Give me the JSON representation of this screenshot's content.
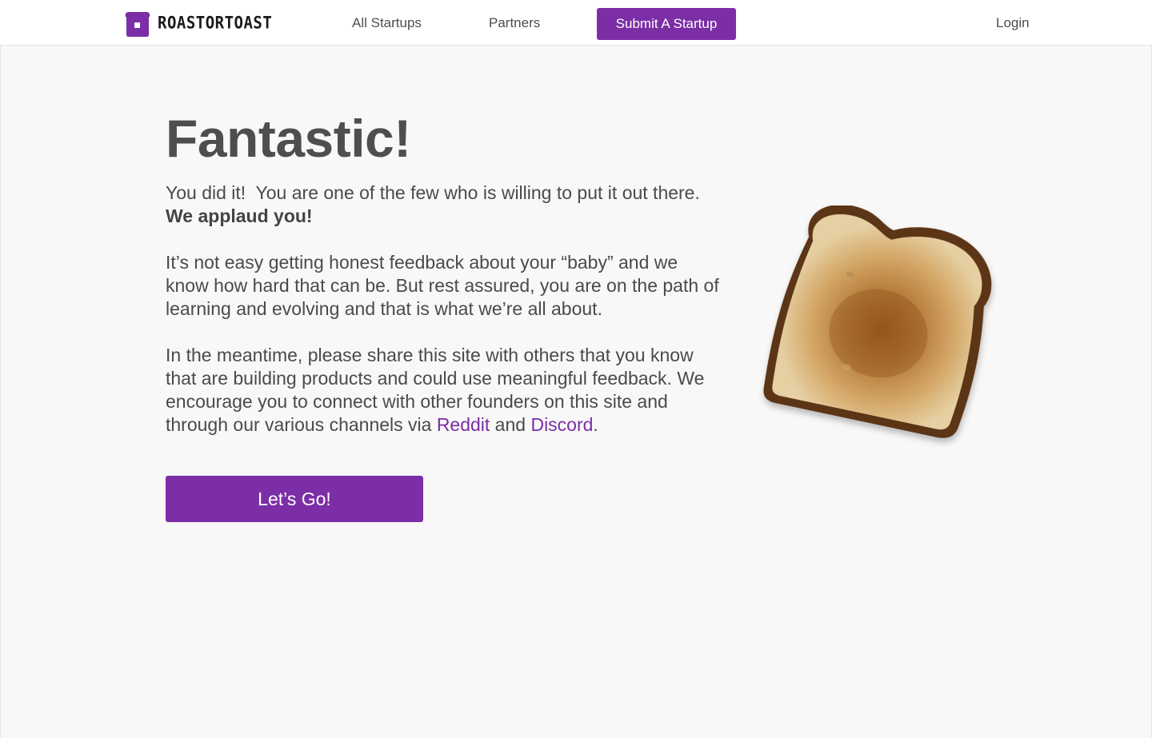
{
  "brand": {
    "name": "ROASTORTOAST",
    "logo_icon": "toast-logo-icon"
  },
  "nav": {
    "all_startups": "All Startups",
    "partners": "Partners",
    "submit": "Submit A Startup",
    "login": "Login"
  },
  "content": {
    "headline": "Fantastic!",
    "p1_text": "You did it!  You are one of the few who is willing to put it out there.  ",
    "p1_bold": "We applaud you!",
    "p2": "It’s not easy getting honest feedback about your “baby” and we know how hard that can be. But rest assured, you are on the path of learning and evolving and that is what we’re all about.",
    "p3_text": "In the meantime, please share this site with others that you know that are building products and could use meaningful feedback. We encourage you to connect with other founders on this site and through our various channels via ",
    "p3_link1": "Reddit",
    "p3_and": " and ",
    "p3_link2": "Discord",
    "p3_end": ".",
    "cta": "Let’s Go!"
  },
  "colors": {
    "accent": "#7b2ea6",
    "text": "#4a4a4a",
    "background": "#f8f8f8"
  },
  "illustration": "toasted-bread-image"
}
